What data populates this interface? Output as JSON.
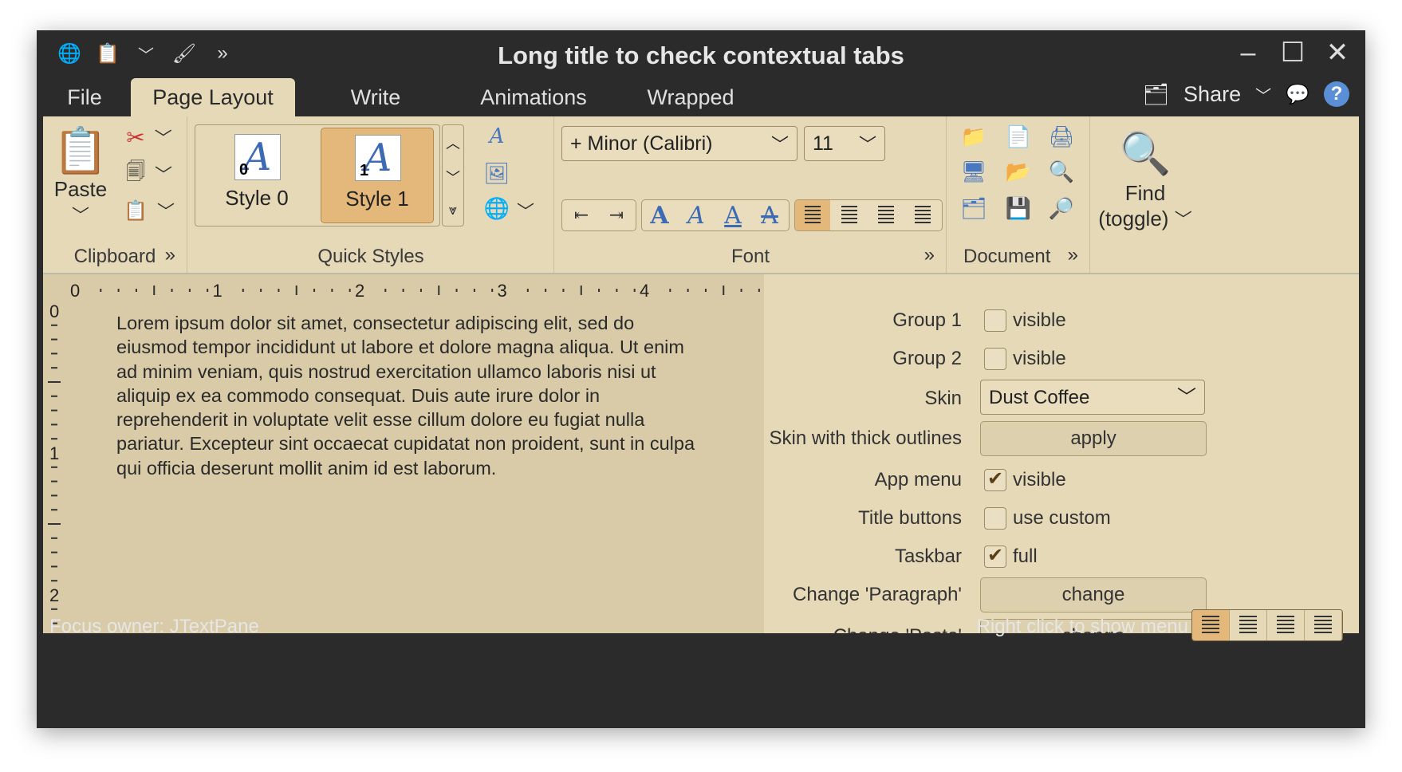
{
  "window": {
    "title": "Long title to check contextual tabs"
  },
  "tabs": {
    "file": "File",
    "page_layout": "Page Layout",
    "write": "Write",
    "animations": "Animations",
    "wrapped": "Wrapped"
  },
  "tab_right": {
    "share": "Share"
  },
  "ribbon": {
    "clipboard": {
      "title": "Clipboard",
      "paste": "Paste"
    },
    "quick_styles": {
      "title": "Quick Styles",
      "style0": "Style 0",
      "style1": "Style 1",
      "num0": "0",
      "num1": "1"
    },
    "font": {
      "title": "Font",
      "family": "+ Minor (Calibri)",
      "size": "11"
    },
    "document": {
      "title": "Document"
    },
    "find": {
      "label_line1": "Find",
      "label_line2": "(toggle)"
    }
  },
  "editor": {
    "ruler_h": [
      "0",
      "1",
      "2",
      "3",
      "4"
    ],
    "ruler_v": [
      "0",
      "1",
      "2"
    ],
    "text": "Lorem ipsum dolor sit amet, consectetur adipiscing elit, sed do eiusmod tempor incididunt ut labore et dolore magna aliqua. Ut enim ad minim veniam, quis nostrud exercitation ullamco laboris nisi ut aliquip ex ea commodo consequat. Duis aute irure dolor in reprehenderit in voluptate velit esse cillum dolore eu fugiat nulla pariatur. Excepteur sint occaecat cupidatat non proident, sunt in culpa qui officia deserunt mollit anim id est laborum."
  },
  "panel": {
    "group1": {
      "label": "Group 1",
      "check": "visible",
      "checked": false
    },
    "group2": {
      "label": "Group 2",
      "check": "visible",
      "checked": false
    },
    "skin": {
      "label": "Skin",
      "value": "Dust Coffee"
    },
    "thick": {
      "label": "Skin with thick outlines",
      "button": "apply"
    },
    "appmenu": {
      "label": "App menu",
      "check": "visible",
      "checked": true
    },
    "titlebuttons": {
      "label": "Title buttons",
      "check": "use custom",
      "checked": false
    },
    "taskbar": {
      "label": "Taskbar",
      "check": "full",
      "checked": true
    },
    "paragraph": {
      "label": "Change 'Paragraph'",
      "button": "change"
    },
    "paste": {
      "label": "Change 'Paste'",
      "button": "change"
    }
  },
  "status": {
    "focus_owner": "Focus owner:  JTextPane",
    "hint": "Right click to show menu"
  },
  "colors": {
    "ribbon": "#e6d9b8",
    "chrome": "#2b2b2b",
    "selected": "#e3b87a"
  }
}
